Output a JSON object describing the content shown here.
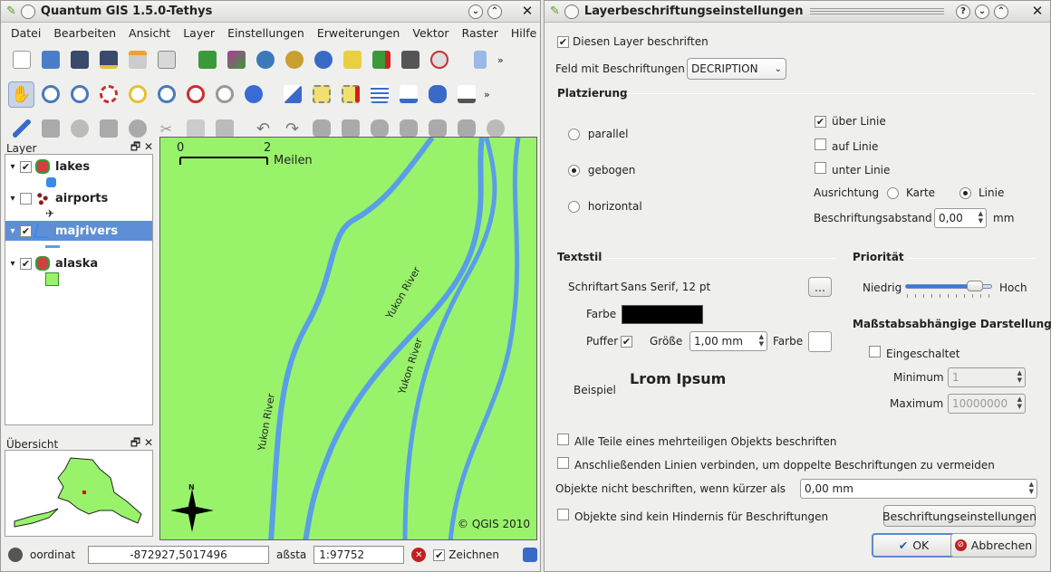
{
  "qgis": {
    "title": "Quantum GIS 1.5.0-Tethys",
    "menu": [
      "Datei",
      "Bearbeiten",
      "Ansicht",
      "Layer",
      "Einstellungen",
      "Erweiterungen",
      "Vektor",
      "Raster",
      "Hilfe"
    ],
    "layer_panel_title": "Layer",
    "layers": [
      {
        "name": "lakes",
        "checked": true
      },
      {
        "name": "airports",
        "checked": false
      },
      {
        "name": "majrivers",
        "checked": true
      },
      {
        "name": "alaska",
        "checked": true
      }
    ],
    "overview_title": "Übersicht",
    "map": {
      "scale_start": "0",
      "scale_end": "2",
      "scale_unit": "Meilen",
      "river_labels": [
        "Yukon River",
        "Yukon River",
        "Yukon River"
      ],
      "copyright": "© QGIS 2010",
      "north": "N",
      "land_color": "#98f36b",
      "river_color": "#5a9ee8"
    },
    "status": {
      "coord_label": "oordinat",
      "coord_value": "-872927,5017496",
      "scale_label": "aßsta",
      "scale_value": "1:97752",
      "render_label": "Zeichnen"
    }
  },
  "dialog": {
    "title": "Layerbeschriftungseinstellungen",
    "label_layer": "Diesen Layer beschriften",
    "field_label": "Feld mit Beschriftungen",
    "field_value": "DECRIPTION",
    "placement_title": "Platzierung",
    "placements": [
      "parallel",
      "gebogen",
      "horizontal"
    ],
    "line_options": [
      "über Linie",
      "auf Linie",
      "unter Linie"
    ],
    "orientation_label": "Ausrichtung",
    "orientation_options": [
      "Karte",
      "Linie"
    ],
    "distance_label": "Beschriftungsabstand",
    "distance_value": "0,00",
    "distance_unit": "mm",
    "textstyle_title": "Textstil",
    "font_label": "Schriftart",
    "font_value": "Sans Serif, 12 pt",
    "font_button": "...",
    "color_label": "Farbe",
    "buffer_label": "Puffer",
    "size_label": "Größe",
    "size_value": "1,00 mm",
    "buffer_color_label": "Farbe",
    "sample_label": "Beispiel",
    "sample_text": "Lrom Ipsum",
    "priority_title": "Priorität",
    "priority_low": "Niedrig",
    "priority_high": "Hoch",
    "scale_title": "Maßstabsabhängige Darstellung",
    "scale_enabled": "Eingeschaltet",
    "min_label": "Minimum",
    "min_value": "1",
    "max_label": "Maximum",
    "max_value": "10000000",
    "opt_parts": "Alle Teile eines mehrteiligen Objekts beschriften",
    "opt_merge": "Anschließenden Linien verbinden, um doppelte Beschriftungen zu vermeiden",
    "opt_short_label": "Objekte nicht beschriften, wenn kürzer als",
    "opt_short_value": "0,00 mm",
    "opt_obstacle": "Objekte sind kein Hindernis für Beschriftungen",
    "engine_button": "Beschriftungseinstellungen",
    "ok_button": "OK",
    "cancel_button": "Abbrechen",
    "priority_fraction": 0.88,
    "text_color": "#000000",
    "buffer_color": "#ffffff"
  }
}
